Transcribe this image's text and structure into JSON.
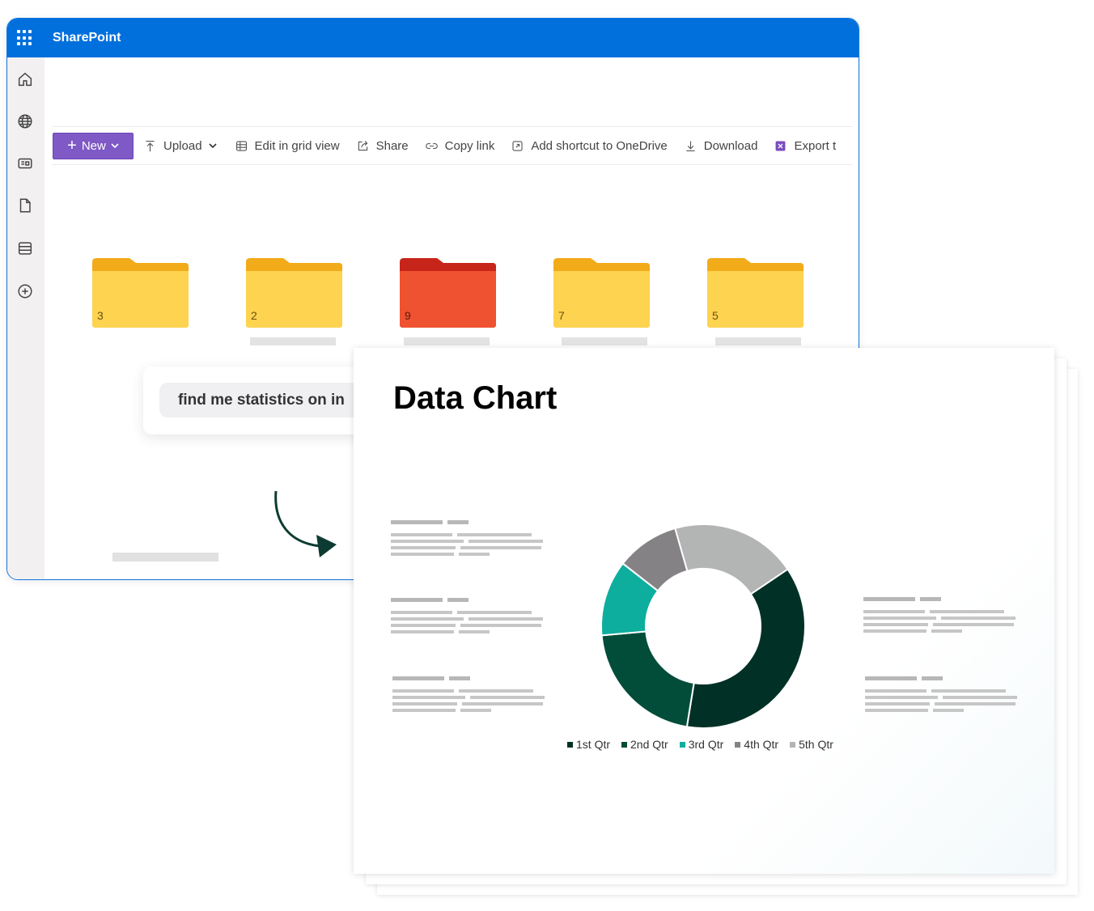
{
  "app": {
    "title": "SharePoint"
  },
  "toolbar": {
    "new_label": "New",
    "upload_label": "Upload",
    "edit_grid_label": "Edit in grid view",
    "share_label": "Share",
    "copy_link_label": "Copy link",
    "add_shortcut_label": "Add shortcut to OneDrive",
    "download_label": "Download",
    "export_label": "Export t"
  },
  "rail": {
    "icons": [
      "home-icon",
      "globe-icon",
      "news-icon",
      "document-icon",
      "list-icon",
      "add-icon"
    ]
  },
  "folders": [
    {
      "label": "3",
      "color": "#fcc83a"
    },
    {
      "label": "2",
      "color": "#fcc83a"
    },
    {
      "label": "9",
      "color": "#e8452a"
    },
    {
      "label": "7",
      "color": "#fcc83a"
    },
    {
      "label": "5",
      "color": "#fcc83a"
    }
  ],
  "chat": {
    "prompt": "find me statistics on in"
  },
  "doc": {
    "title": "Data Chart"
  },
  "chart_data": {
    "type": "pie",
    "title": "Data Chart",
    "categories": [
      "1st Qtr",
      "2nd Qtr",
      "3rd Qtr",
      "4th Qtr",
      "5th Qtr"
    ],
    "values": [
      37,
      21,
      12,
      10,
      20
    ],
    "colors": [
      "#013126",
      "#024d3a",
      "#0eae9f",
      "#858285",
      "#b3b5b4"
    ],
    "legend": "bottom"
  },
  "colors": {
    "brand": "#0170dc",
    "accent": "#7f59c6"
  }
}
